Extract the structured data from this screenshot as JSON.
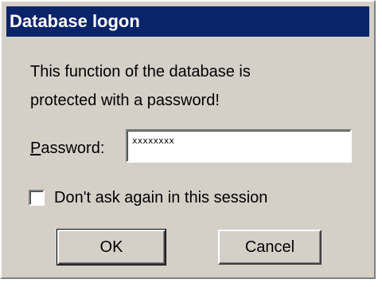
{
  "window": {
    "title": "Database logon",
    "title_bar_color": "#0a246a",
    "background_color": "#d4d0c8"
  },
  "message": {
    "line1": "This function of the database is",
    "line2": "protected with a password!"
  },
  "password": {
    "label_accel": "P",
    "label_rest": "assword:",
    "value": "xxxxxxxx"
  },
  "checkbox": {
    "label": "Don't ask again in this session",
    "checked": false
  },
  "buttons": {
    "ok_label": "OK",
    "cancel_label": "Cancel"
  }
}
